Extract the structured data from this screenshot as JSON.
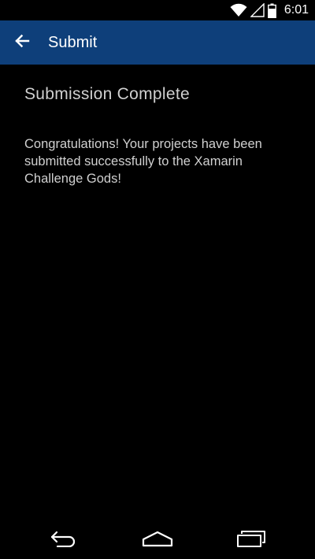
{
  "status_bar": {
    "time": "6:01",
    "icons": [
      "wifi-icon",
      "signal-icon",
      "battery-icon"
    ]
  },
  "app_bar": {
    "title": "Submit",
    "back_icon": "arrow-left-icon",
    "background_color": "#0e3f7a"
  },
  "content": {
    "title": "Submission Complete",
    "message": "Congratulations! Your projects have been submitted successfully to the Xamarin Challenge Gods!"
  },
  "nav_bar": {
    "buttons": [
      "back-icon",
      "home-icon",
      "recents-icon"
    ]
  }
}
